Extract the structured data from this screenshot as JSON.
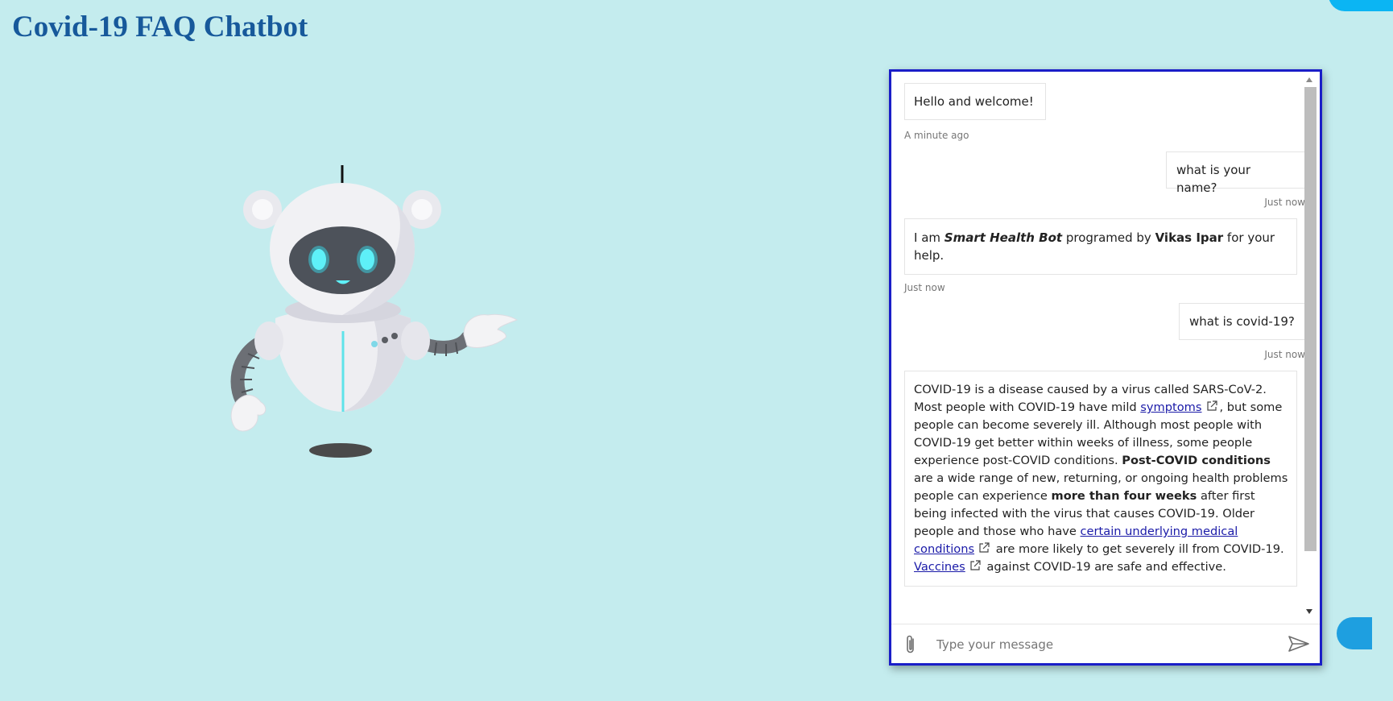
{
  "page": {
    "title": "Covid-19 FAQ Chatbot"
  },
  "chat": {
    "messages": [
      {
        "from": "bot",
        "text": "Hello and welcome!",
        "time": "A minute ago"
      },
      {
        "from": "user",
        "text": "what is your name?",
        "time": "Just now"
      },
      {
        "from": "bot",
        "time": "Just now",
        "parts": {
          "p1": "I am ",
          "b1": "Smart Health Bot",
          "p2": " programed by ",
          "b2": "Vikas Ipar",
          "p3": " for your help."
        }
      },
      {
        "from": "user",
        "text": "what is covid-19?",
        "time": "Just now"
      },
      {
        "from": "bot",
        "parts": {
          "t1": "COVID-19 is a disease caused by a virus called SARS-CoV-2. Most people with COVID-19 have mild ",
          "link1": "symptoms",
          "t2": ", but some people can become severely ill. Although most people with COVID-19 get better within weeks of illness, some people experience post-COVID conditions. ",
          "b1": "Post-COVID conditions",
          "t3": " are a wide range of new, returning, or ongoing health problems people can experience ",
          "b2": "more than four weeks",
          "t4": " after first being infected with the virus that causes COVID-19. Older people and those who have ",
          "link2": "certain underlying medical conditions",
          "t5": " are more likely to get severely ill from COVID-19. ",
          "link3": "Vaccines",
          "t6": " against COVID-19 are safe and effective."
        }
      }
    ],
    "composer": {
      "placeholder": "Type your message"
    }
  },
  "icons": {
    "attach": "paperclip-icon",
    "send": "send-icon",
    "external": "external-link-icon"
  },
  "colors": {
    "page_background": "#c4ecee",
    "title": "#17599b",
    "chat_border": "#1a1ec8",
    "link": "#1a1aa8"
  }
}
